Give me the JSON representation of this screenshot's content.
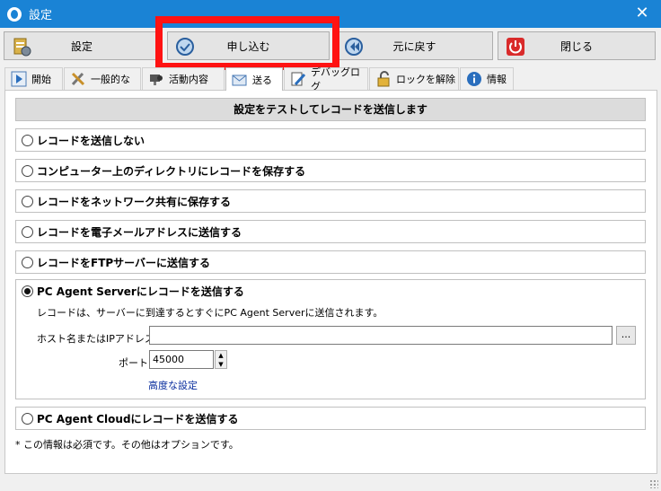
{
  "window": {
    "title": "設定",
    "close_glyph": "✕"
  },
  "toolbar": {
    "settings_label": "設定",
    "apply_label": "申し込む",
    "revert_label": "元に戻す",
    "close_label": "閉じる"
  },
  "tabs": [
    {
      "label": "開始"
    },
    {
      "label": "一般的な"
    },
    {
      "label": "活動内容"
    },
    {
      "label": "送る"
    },
    {
      "label": "デバッグログ"
    },
    {
      "label": "ロックを解除"
    },
    {
      "label": "情報"
    }
  ],
  "panel": {
    "header": "設定をテストしてレコードを送信します",
    "options": [
      {
        "label": "レコードを送信しない",
        "selected": false
      },
      {
        "label": "コンピューター上のディレクトリにレコードを保存する",
        "selected": false
      },
      {
        "label": "レコードをネットワーク共有に保存する",
        "selected": false
      },
      {
        "label": "レコードを電子メールアドレスに送信する",
        "selected": false
      },
      {
        "label": "レコードをFTPサーバーに送信する",
        "selected": false
      }
    ],
    "server": {
      "label": "PC Agent Serverにレコードを送信する",
      "selected": true,
      "description": "レコードは、サーバーに到達するとすぐにPC Agent Serverに送信されます。",
      "host_label": "ホスト名またはIPアドレス*:",
      "host_value": "",
      "browse_label": "...",
      "port_label": "ポート:",
      "port_value": "45000",
      "advanced_link": "高度な設定"
    },
    "cloud": {
      "label": "PC Agent Cloudにレコードを送信する",
      "selected": false
    },
    "footnote": "* この情報は必須です。その他はオプションです。"
  },
  "colors": {
    "titlebar": "#1a83d5",
    "highlight": "#ff1212",
    "link": "#0a2e9e"
  }
}
